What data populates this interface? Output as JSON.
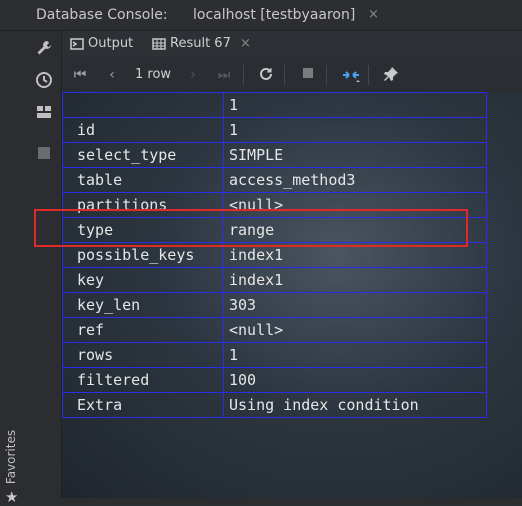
{
  "window": {
    "title": "Database Console:",
    "tab_label": "localhost [testbyaaron]",
    "tab_close": "×"
  },
  "tool_tabs": {
    "output_label": "Output",
    "result_label": "Result 67",
    "result_close": "×"
  },
  "toolbar": {
    "row_count": "1 row"
  },
  "sidebar": {
    "favorites_label": "Favorites"
  },
  "grid": {
    "header_value": "1",
    "rows": [
      {
        "key": "id",
        "value": "1",
        "is_null": false
      },
      {
        "key": "select_type",
        "value": "SIMPLE",
        "is_null": false
      },
      {
        "key": "table",
        "value": "access_method3",
        "is_null": false
      },
      {
        "key": "partitions",
        "value": "<null>",
        "is_null": true
      },
      {
        "key": "type",
        "value": "range",
        "is_null": false
      },
      {
        "key": "possible_keys",
        "value": "index1",
        "is_null": false
      },
      {
        "key": "key",
        "value": "index1",
        "is_null": false
      },
      {
        "key": "key_len",
        "value": "303",
        "is_null": false
      },
      {
        "key": "ref",
        "value": "<null>",
        "is_null": true
      },
      {
        "key": "rows",
        "value": "1",
        "is_null": false
      },
      {
        "key": "filtered",
        "value": "100",
        "is_null": false
      },
      {
        "key": "Extra",
        "value": "Using index condition",
        "is_null": false
      }
    ]
  },
  "colors": {
    "grid_border": "#2b2ee8",
    "null_value": "#7ed321",
    "highlight_box": "#e02a2a"
  }
}
